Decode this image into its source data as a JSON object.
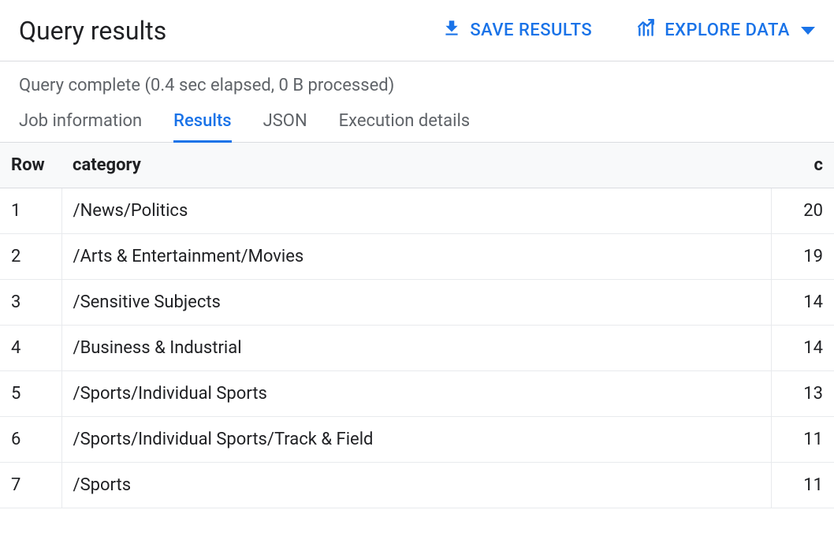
{
  "header": {
    "title": "Query results",
    "save_label": "SAVE RESULTS",
    "explore_label": "EXPLORE DATA"
  },
  "status": "Query complete (0.4 sec elapsed, 0 B processed)",
  "tabs": [
    {
      "label": "Job information",
      "active": false
    },
    {
      "label": "Results",
      "active": true
    },
    {
      "label": "JSON",
      "active": false
    },
    {
      "label": "Execution details",
      "active": false
    }
  ],
  "table": {
    "columns": {
      "row": "Row",
      "category": "category",
      "c": "c"
    },
    "rows": [
      {
        "row": "1",
        "category": "/News/Politics",
        "c": "20"
      },
      {
        "row": "2",
        "category": "/Arts & Entertainment/Movies",
        "c": "19"
      },
      {
        "row": "3",
        "category": "/Sensitive Subjects",
        "c": "14"
      },
      {
        "row": "4",
        "category": "/Business & Industrial",
        "c": "14"
      },
      {
        "row": "5",
        "category": "/Sports/Individual Sports",
        "c": "13"
      },
      {
        "row": "6",
        "category": "/Sports/Individual Sports/Track & Field",
        "c": "11"
      },
      {
        "row": "7",
        "category": "/Sports",
        "c": "11"
      }
    ]
  }
}
